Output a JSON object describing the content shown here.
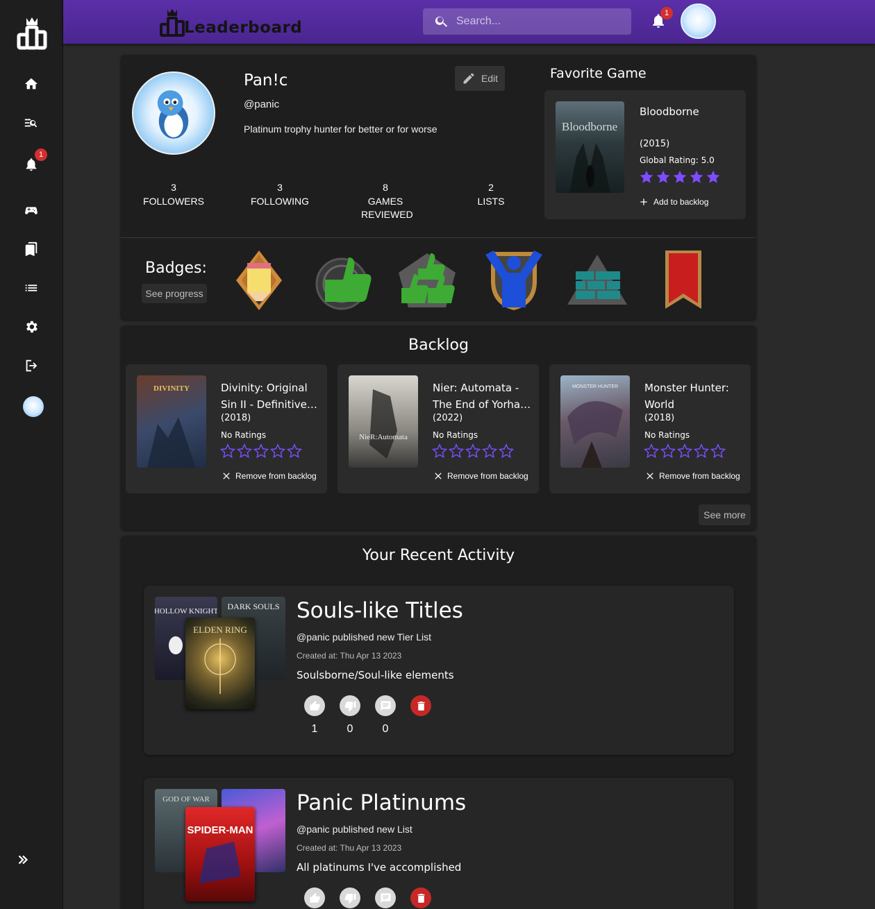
{
  "app": {
    "brand": "Leaderboard",
    "notification_count": "1"
  },
  "search": {
    "placeholder": "Search..."
  },
  "sidebar": {
    "items": [
      {
        "name": "home-icon"
      },
      {
        "name": "search-list-icon"
      },
      {
        "name": "bell-icon",
        "badge": "1"
      },
      {
        "name": "gamepad-icon"
      },
      {
        "name": "bookmarks-icon"
      },
      {
        "name": "list-icon"
      },
      {
        "name": "gear-icon"
      },
      {
        "name": "logout-icon"
      }
    ]
  },
  "profile": {
    "username": "Pan!c",
    "handle": "@panic",
    "bio": "Platinum trophy hunter for better or for worse",
    "edit_label": "Edit",
    "stats": [
      {
        "value": "3",
        "label": "FOLLOWERS"
      },
      {
        "value": "3",
        "label": "FOLLOWING"
      },
      {
        "value": "8",
        "label": "GAMES REVIEWED"
      },
      {
        "value": "2",
        "label": "LISTS"
      }
    ],
    "favorite": {
      "heading": "Favorite Game",
      "name": "Bloodborne",
      "year": "(2015)",
      "rating": "Global Rating: 5.0",
      "rating_value": 5,
      "add_label": "Add to backlog",
      "cover_text": "Bloodborne"
    },
    "badges_label": "Badges:",
    "see_progress": "See progress",
    "badges": [
      "pencil-badge-icon",
      "thumbs-up-badge-icon",
      "double-thumbs-badge-icon",
      "person-shield-badge-icon",
      "stacked-bricks-badge-icon",
      "bookmark-badge-icon"
    ]
  },
  "backlog": {
    "title": "Backlog",
    "items": [
      {
        "title": "Divinity: Original Sin II - Definitive Edition",
        "year": "(2018)",
        "rating": "No Ratings",
        "remove": "Remove from backlog",
        "cover_text": "DIVINITY"
      },
      {
        "title": "Nier: Automata - The End of Yorha Edition",
        "year": "(2022)",
        "rating": "No Ratings",
        "remove": "Remove from backlog",
        "cover_text": "NieR:Automata"
      },
      {
        "title": "Monster Hunter: World",
        "year": "(2018)",
        "rating": "No Ratings",
        "remove": "Remove from backlog",
        "cover_text": "MONSTER HUNTER"
      }
    ],
    "see_more": "See more"
  },
  "activity": {
    "title": "Your Recent Activity",
    "items": [
      {
        "title": "Souls-like Titles",
        "subtitle": "@panic published new Tier List",
        "date": "Created at: Thu Apr 13 2023",
        "description": "Soulsborne/Soul-like elements",
        "likes": "1",
        "dislikes": "0",
        "comments": "0",
        "covers": [
          "HOLLOW KNIGHT",
          "DARK SOULS",
          "ELDEN RING"
        ]
      },
      {
        "title": "Panic Platinums",
        "subtitle": "@panic published new List",
        "date": "Created at: Thu Apr 13 2023",
        "description": "All platinums I've accomplished",
        "covers": [
          "GOD OF WAR",
          "SPIDER-MAN"
        ]
      }
    ]
  },
  "colors": {
    "accent": "#7c4dff",
    "topbar": "#4f2996",
    "danger": "#c62828"
  }
}
